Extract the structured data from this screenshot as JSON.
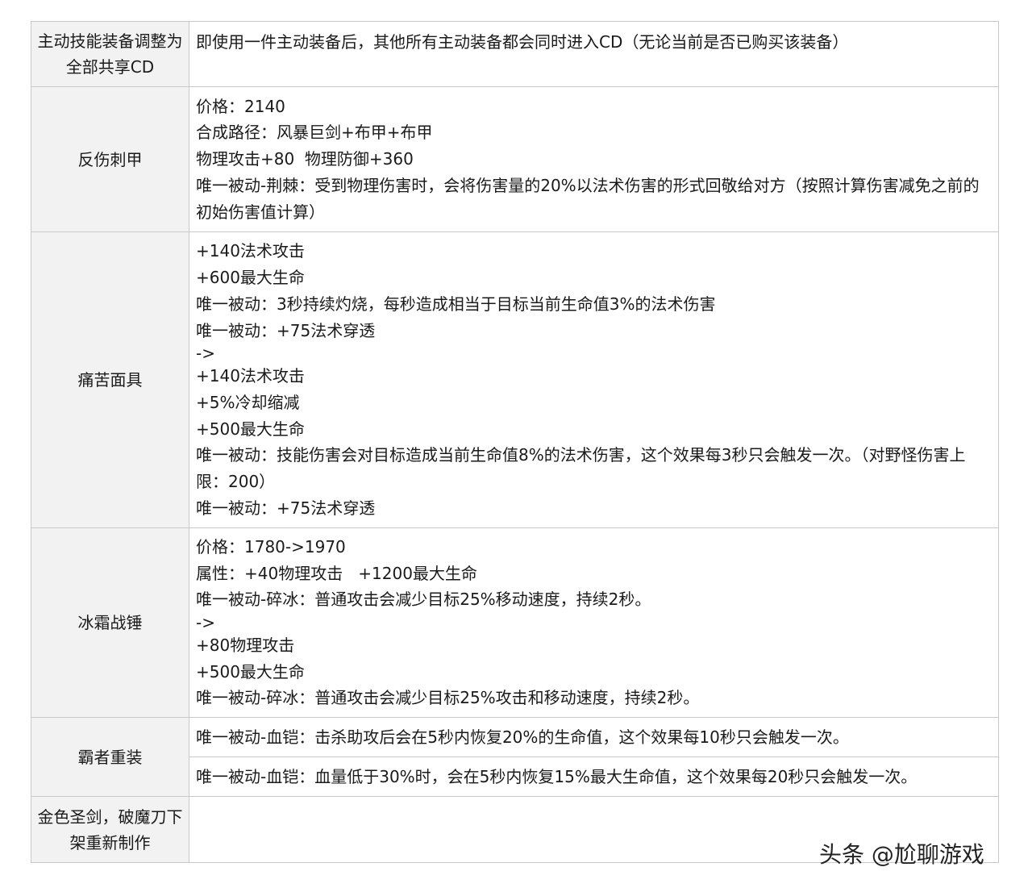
{
  "rows": [
    {
      "label": "主动技能装备调整为全部共享CD",
      "lines": [
        "即使用一件主动装备后，其他所有主动装备都会同时进入CD（无论当前是否已购买该装备）"
      ]
    },
    {
      "label": "反伤刺甲",
      "lines": [
        "价格：2140",
        "合成路径：风暴巨剑+布甲+布甲",
        "物理攻击+80  物理防御+360",
        "唯一被动-荆棘：受到物理伤害时，会将伤害量的20%以法术伤害的形式回敬给对方（按照计算伤害减免之前的初始伤害值计算）"
      ]
    },
    {
      "label": "痛苦面具",
      "lines": [
        "+140法术攻击",
        "+600最大生命",
        "唯一被动：3秒持续灼烧，每秒造成相当于目标当前生命值3%的法术伤害",
        "唯一被动：+75法术穿透",
        "->",
        "+140法术攻击",
        "+5%冷却缩减",
        "+500最大生命",
        "唯一被动：技能伤害会对目标造成当前生命值8%的法术伤害，这个效果每3秒只会触发一次。（对野怪伤害上限：200）",
        "唯一被动：+75法术穿透"
      ]
    },
    {
      "label": "冰霜战锤",
      "lines": [
        "价格：1780->1970",
        "属性：+40物理攻击   +1200最大生命",
        "唯一被动-碎冰：普通攻击会减少目标25%移动速度，持续2秒。",
        "->",
        "+80物理攻击",
        "+500最大生命",
        "唯一被动-碎冰：普通攻击会减少目标25%攻击和移动速度，持续2秒。"
      ]
    },
    {
      "label": "霸者重装",
      "lines_a": [
        "唯一被动-血铠：击杀助攻后会在5秒内恢复20%的生命值，这个效果每10秒只会触发一次。"
      ],
      "lines_b": [
        "唯一被动-血铠：血量低于30%时，会在5秒内恢复15%最大生命值，这个效果每20秒只会触发一次。"
      ]
    },
    {
      "label": "金色圣剑，破魔刀下架重新制作",
      "lines": []
    }
  ],
  "watermark": "头条 @尬聊游戏"
}
